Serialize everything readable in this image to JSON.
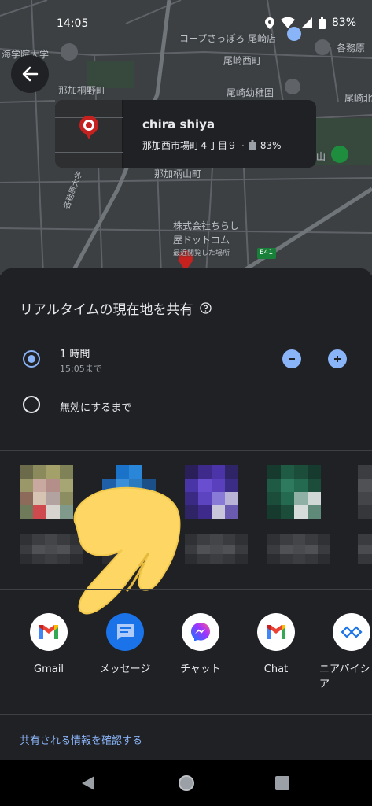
{
  "status_bar": {
    "time": "14:05",
    "battery": "83%"
  },
  "map": {
    "labels": [
      "海学院大学",
      "コープさっぽろ 尾崎店",
      "各務原",
      "尾崎西町",
      "那加桐野町",
      "尾崎幼稚園",
      "尾崎北",
      "那加柄山町",
      "山",
      "株式会社ちらし",
      "屋ドットコム",
      "最近閲覧した場所",
      "E41",
      "各務原大学"
    ]
  },
  "location_card": {
    "name": "chira shiya",
    "address": "那加西市場町４丁目９",
    "separator": "·",
    "battery": "83%"
  },
  "sheet": {
    "title": "リアルタイムの現在地を共有",
    "option1": {
      "label": "1 時間",
      "sub": "15:05まで"
    },
    "option2": {
      "label": "無効にするまで"
    },
    "apps": [
      {
        "label": "Gmail"
      },
      {
        "label": "メッセージ"
      },
      {
        "label": "チャット"
      },
      {
        "label": "Chat"
      },
      {
        "label": "ニアバイシ\nア"
      }
    ],
    "confirm_link": "共有される情報を確認する"
  },
  "colors": {
    "accent": "#8ab4f8",
    "sheet_bg": "#202124",
    "map_bg": "#3c4043"
  }
}
